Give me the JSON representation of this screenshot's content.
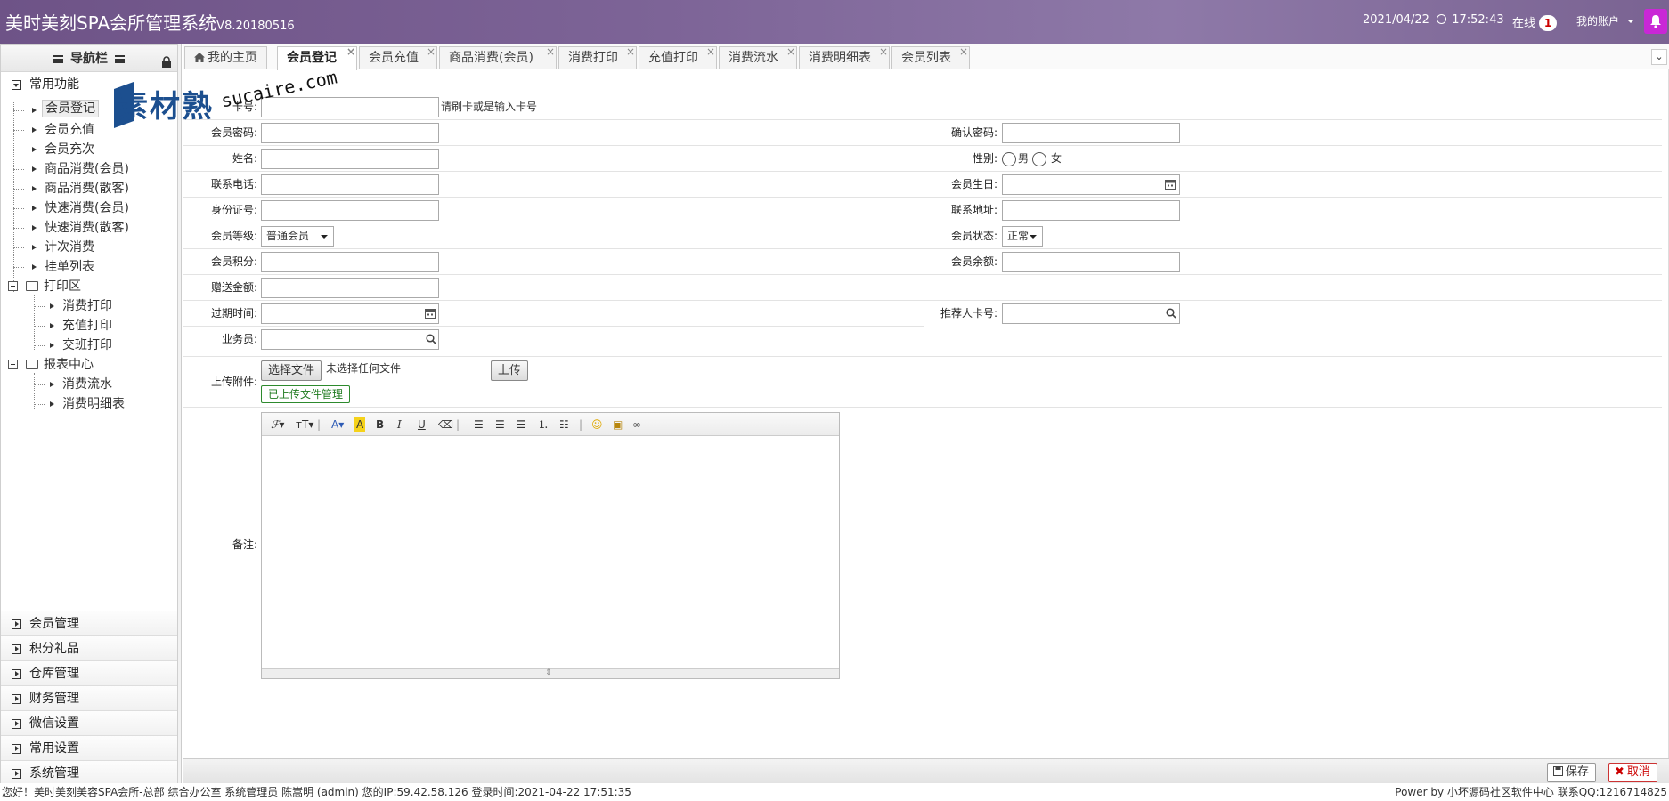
{
  "header": {
    "title": "美时美刻SPA会所管理系统",
    "version": "V8.20180516",
    "datetime": "2021/04/22",
    "time": "17:52:43",
    "online_label": "在线",
    "online_count": "1",
    "account_label": "我的账户"
  },
  "sidebar": {
    "nav_title": "导航栏",
    "common_group": "常用功能",
    "common_items": [
      "会员登记",
      "会员充值",
      "会员充次",
      "商品消费(会员)",
      "商品消费(散客)",
      "快速消费(会员)",
      "快速消费(散客)",
      "计次消费",
      "挂单列表"
    ],
    "print_folder": "打印区",
    "print_items": [
      "消费打印",
      "充值打印",
      "交班打印"
    ],
    "report_folder": "报表中心",
    "report_items": [
      "消费流水",
      "消费明细表"
    ],
    "bottom_groups": [
      "会员管理",
      "积分礼品",
      "仓库管理",
      "财务管理",
      "微信设置",
      "常用设置",
      "系统管理"
    ]
  },
  "tabs": {
    "home": "我的主页",
    "items": [
      "会员登记",
      "会员充值",
      "商品消费(会员)",
      "消费打印",
      "充值打印",
      "消费流水",
      "消费明细表",
      "会员列表"
    ]
  },
  "form": {
    "card_label": "卡号:",
    "card_hint": "请刷卡或是输入卡号",
    "password_label": "会员密码:",
    "confirm_password_label": "确认密码:",
    "name_label": "姓名:",
    "gender_label": "性别:",
    "gender_male": "男",
    "gender_female": "女",
    "phone_label": "联系电话:",
    "birthday_label": "会员生日:",
    "id_label": "身份证号:",
    "address_label": "联系地址:",
    "level_label": "会员等级:",
    "level_value": "普通会员",
    "status_label": "会员状态:",
    "status_value": "正常",
    "points_label": "会员积分:",
    "balance_label": "会员余额:",
    "gift_label": "赠送金额:",
    "expire_label": "过期时间:",
    "referrer_label": "推荐人卡号:",
    "salesman_label": "业务员:",
    "upload_label": "上传附件:",
    "choose_file": "选择文件",
    "no_file": "未选择任何文件",
    "upload_button": "上传",
    "uploaded_manage": "已上传文件管理",
    "remark_label": "备注:"
  },
  "actions": {
    "save": "保存",
    "cancel": "取消"
  },
  "statusbar": {
    "left": "您好！美时美刻美容SPA会所-总部 综合办公室 系统管理员 陈嵩明 (admin) 您的IP:59.42.58.126 登录时间:2021-04-22 17:51:35",
    "right": "Power by 小坏源码社区软件中心 联系QQ:1216714825"
  },
  "watermark": {
    "cn": "素材熟",
    "en": "sucaire.com"
  },
  "colors": {
    "header": "#7d6497",
    "bell": "#c927d6",
    "cancel": "#cc0000",
    "green": "#1d7a1d"
  }
}
